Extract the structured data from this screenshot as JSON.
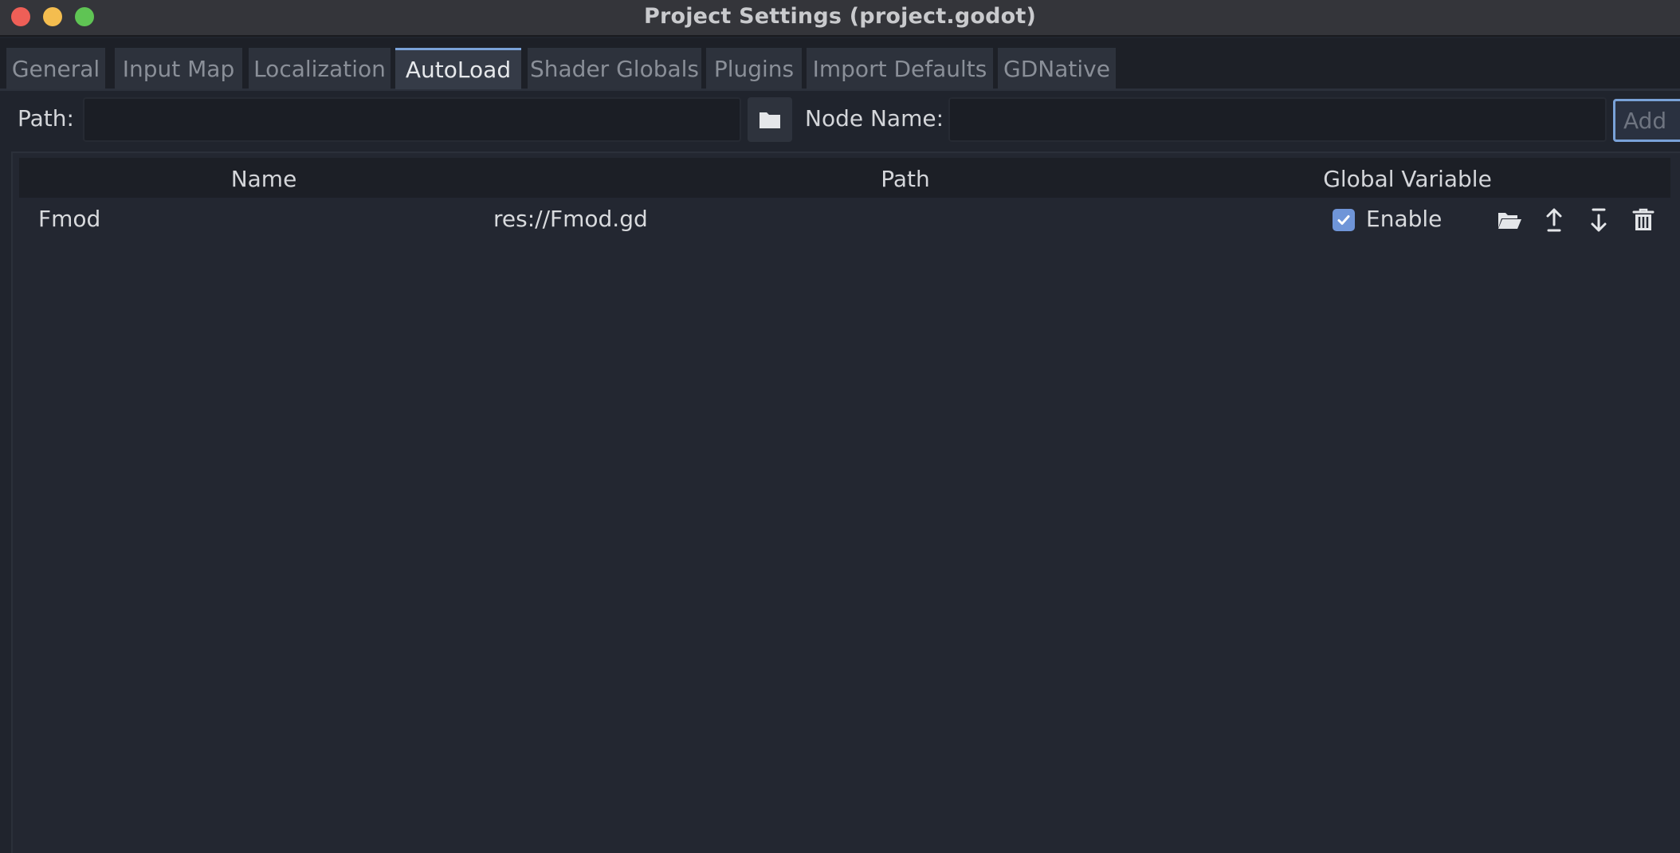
{
  "window": {
    "title": "Project Settings (project.godot)"
  },
  "tabs": [
    {
      "label": "General",
      "active": false
    },
    {
      "label": "Input Map",
      "active": false
    },
    {
      "label": "Localization",
      "active": false
    },
    {
      "label": "AutoLoad",
      "active": true
    },
    {
      "label": "Shader Globals",
      "active": false
    },
    {
      "label": "Plugins",
      "active": false
    },
    {
      "label": "Import Defaults",
      "active": false
    },
    {
      "label": "GDNative",
      "active": false
    }
  ],
  "toolbar": {
    "path_label": "Path:",
    "path_value": "",
    "node_name_label": "Node Name:",
    "node_name_value": "",
    "add_label": "Add",
    "browse_icon": "folder-icon"
  },
  "table": {
    "columns": [
      "Name",
      "Path",
      "Global Variable"
    ],
    "rows": [
      {
        "name": "Fmod",
        "path": "res://Fmod.gd",
        "global_enabled": true,
        "global_label": "Enable",
        "actions": [
          "open-folder-icon",
          "move-up-icon",
          "move-down-icon",
          "delete-icon"
        ]
      }
    ]
  },
  "colors": {
    "accent": "#7aa2d8",
    "checkbox": "#6f95d8",
    "close": "#ee5f57",
    "minimize": "#f4bd4f",
    "maximize": "#5fc454"
  }
}
